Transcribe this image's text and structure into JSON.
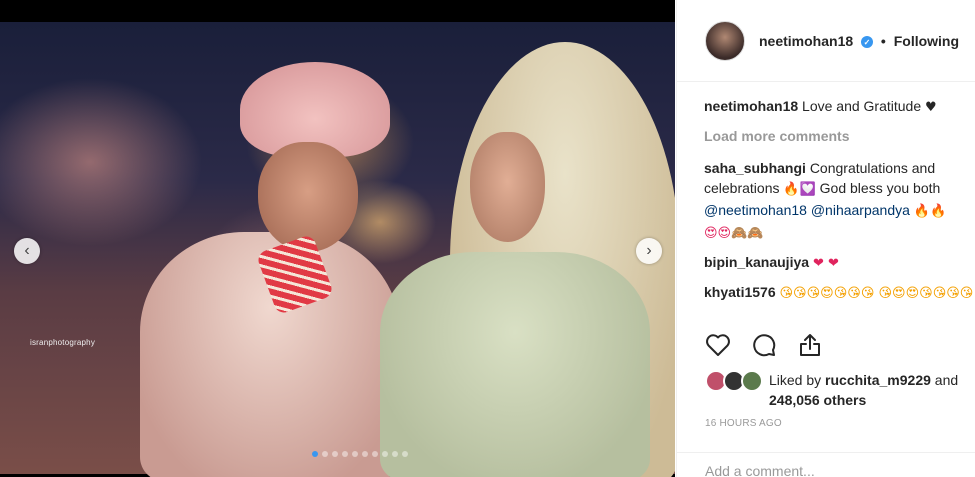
{
  "media": {
    "watermark": "isranphotography",
    "carousel_total": 10,
    "carousel_active": 0,
    "prev_glyph": "‹",
    "next_glyph": "›"
  },
  "header": {
    "username": "neetimohan18",
    "verified_icon": "verified-badge-icon",
    "separator": "•",
    "follow_status": "Following"
  },
  "caption": {
    "username": "neetimohan18",
    "text": "Love and Gratitude",
    "emoji": "♥"
  },
  "load_more": "Load more comments",
  "comments": [
    {
      "username": "saha_subhangi",
      "text": "Congratulations and celebrations",
      "emoji_1": "🔥",
      "emoji_2": "💟",
      "text_2": "God bless you both",
      "mention_1": "@neetimohan18",
      "mention_2": "@nihaarpandya",
      "emoji_3": "🔥🔥",
      "emoji_4": "😍😍🙈🙈"
    },
    {
      "username": "bipin_kanaujiya",
      "emoji": "❤ ❤"
    },
    {
      "username": "khyati1576",
      "emoji": "😘😘😘😍😘😘😘 😘😍😍😘😘😘😘"
    }
  ],
  "likes": {
    "prefix": "Liked by",
    "user": "rucchita_m9229",
    "and": "and",
    "count": "248,056 others"
  },
  "timestamp": "16 HOURS AGO",
  "add_comment_placeholder": "Add a comment...",
  "colors": {
    "accent_blue": "#3897f0",
    "heart_red": "#e0245e",
    "muted": "#999999"
  }
}
